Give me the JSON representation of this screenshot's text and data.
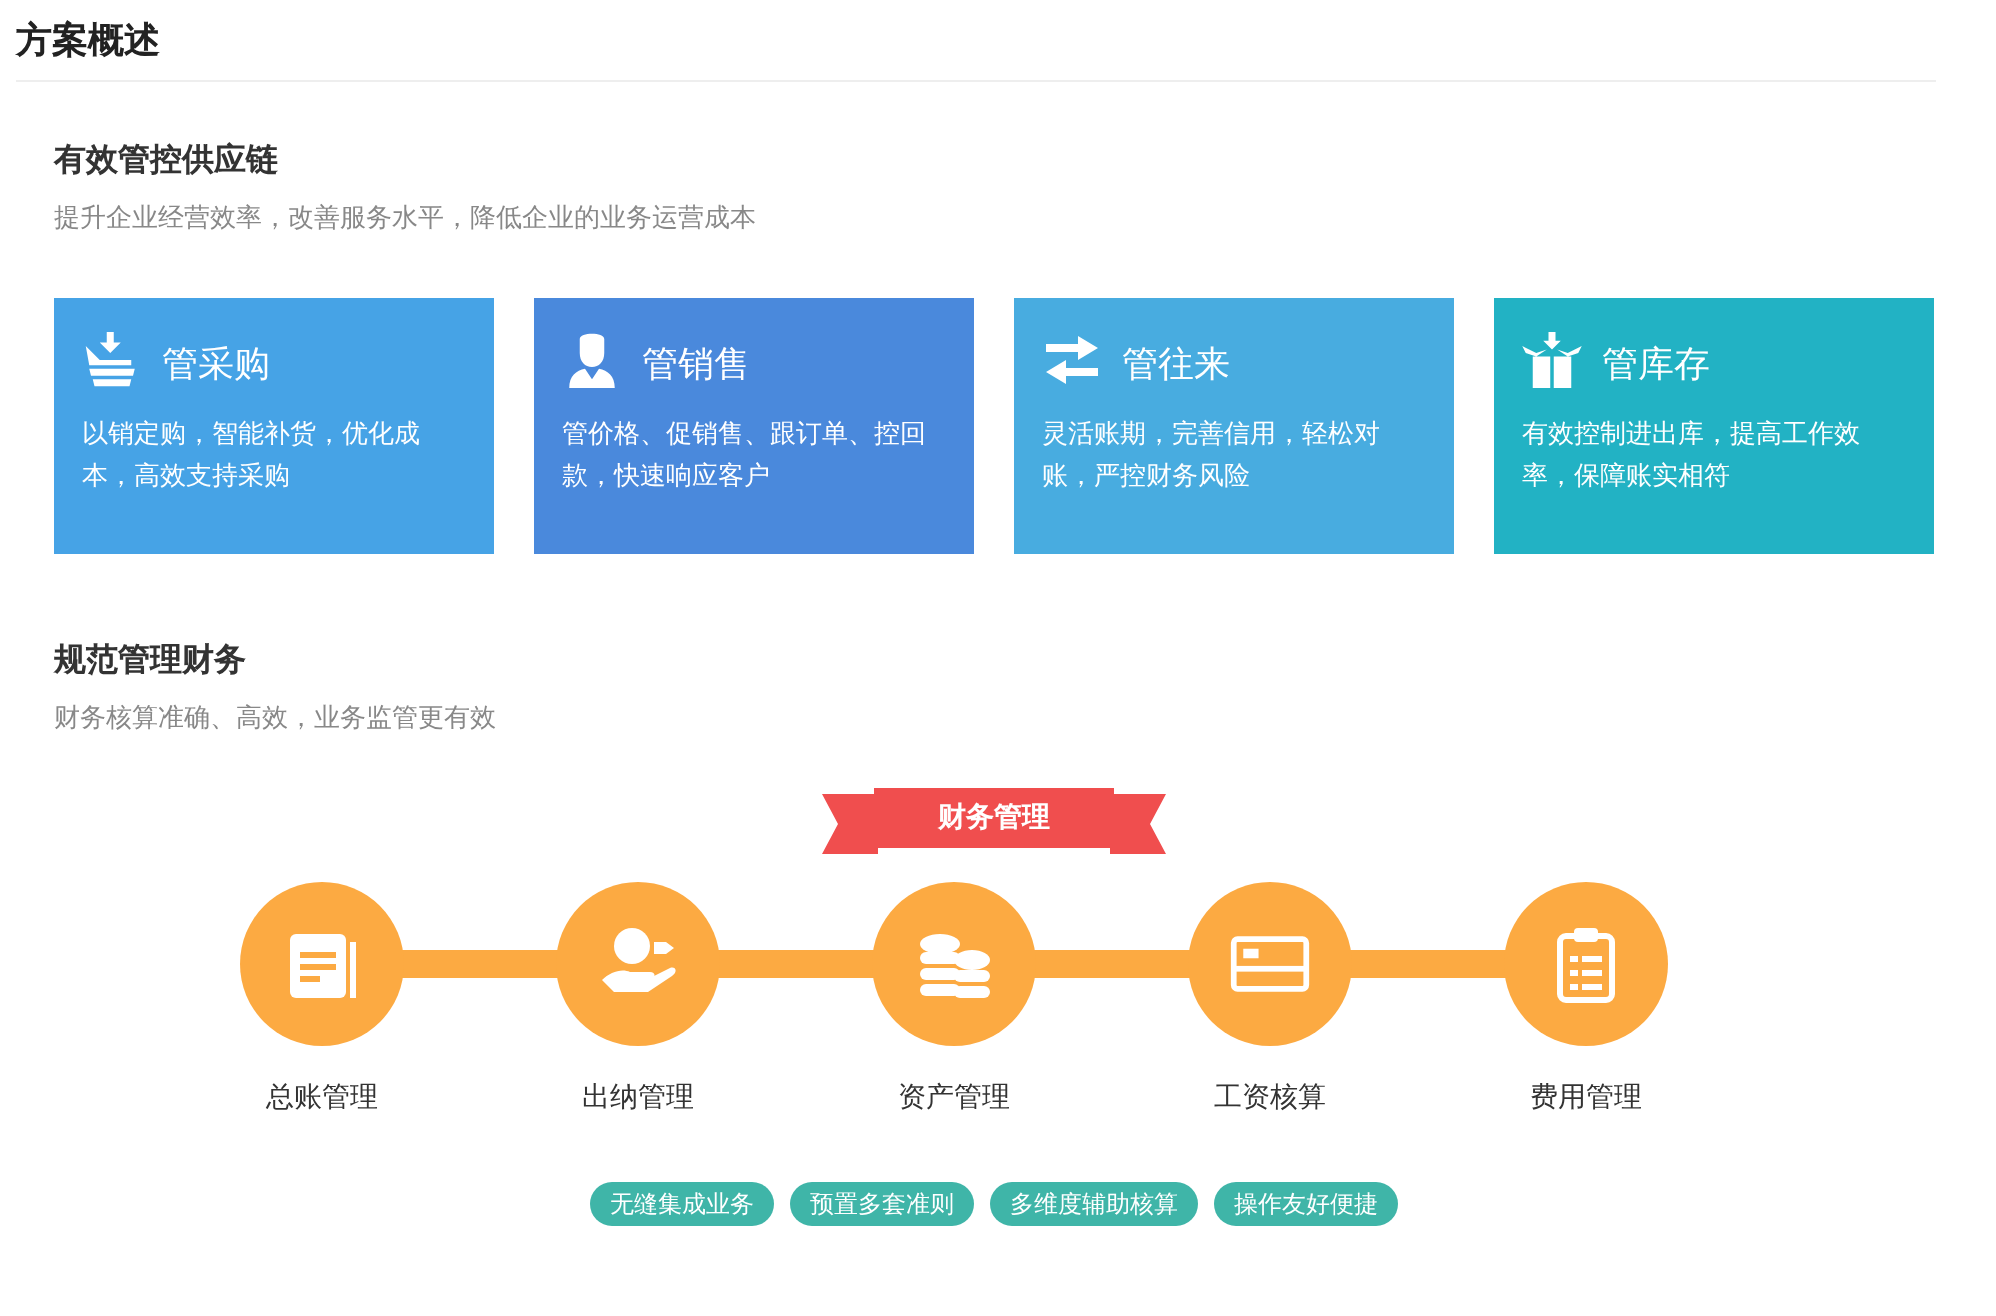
{
  "page_title": "方案概述",
  "supply_section": {
    "title": "有效管控供应链",
    "subtitle": "提升企业经营效率，改善服务水平，降低企业的业务运营成本",
    "cards": [
      {
        "title": "管采购",
        "text": "以销定购，智能补货，优化成本，高效支持采购",
        "color": "#46a3e6"
      },
      {
        "title": "管销售",
        "text": "管价格、促销售、跟订单、控回款，快速响应客户",
        "color": "#4a89dc"
      },
      {
        "title": "管往来",
        "text": "灵活账期，完善信用，轻松对账，严控财务风险",
        "color": "#48ace0"
      },
      {
        "title": "管库存",
        "text": "有效控制进出库，提高工作效率，保障账实相符",
        "color": "#22b2c4"
      }
    ]
  },
  "finance_section": {
    "title": "规范管理财务",
    "subtitle": "财务核算准确、高效，业务监管更有效",
    "ribbon": "财务管理",
    "steps": [
      {
        "label": "总账管理"
      },
      {
        "label": "出纳管理"
      },
      {
        "label": "资产管理"
      },
      {
        "label": "工资核算"
      },
      {
        "label": "费用管理"
      }
    ],
    "tags": [
      "无缝集成业务",
      "预置多套准则",
      "多维度辅助核算",
      "操作友好便捷"
    ]
  }
}
